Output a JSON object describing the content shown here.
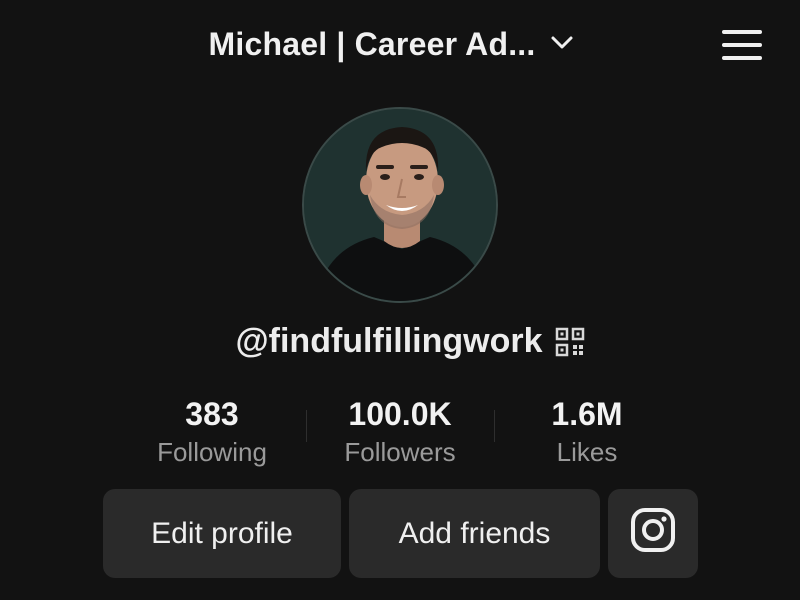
{
  "header": {
    "title": "Michael | Career Ad...",
    "chevron_icon": "chevron-down-icon",
    "menu_icon": "hamburger-menu-icon"
  },
  "profile": {
    "avatar_icon": "profile-photo",
    "handle": "@findfulfillingwork",
    "qr_icon": "qr-code-icon"
  },
  "stats": [
    {
      "value": "383",
      "label": "Following"
    },
    {
      "value": "100.0K",
      "label": "Followers"
    },
    {
      "value": "1.6M",
      "label": "Likes"
    }
  ],
  "actions": {
    "edit_profile": "Edit profile",
    "add_friends": "Add friends",
    "instagram_icon": "instagram-icon"
  },
  "colors": {
    "background": "#121212",
    "button_bg": "#2a2a2a",
    "text_primary": "#f2f2f2",
    "text_secondary": "#9a9a9a"
  }
}
